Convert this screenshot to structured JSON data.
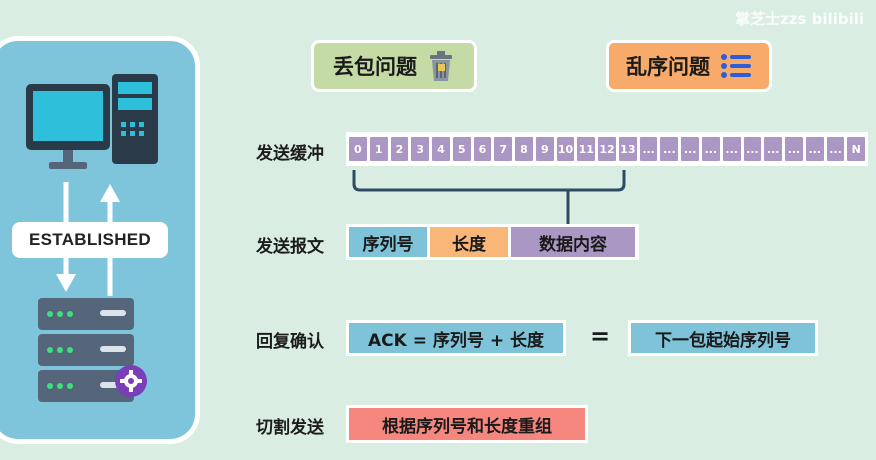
{
  "watermark": "掌芝士zzs bilibili",
  "left_panel": {
    "connection_state": "ESTABLISHED"
  },
  "tags": {
    "packet_loss": "丢包问题",
    "out_of_order": "乱序问题"
  },
  "rows": {
    "send_buffer_label": "发送缓冲",
    "send_segment_label": "发送报文",
    "ack_label": "回复确认",
    "split_label": "切割发送"
  },
  "buffer_cells": [
    "0",
    "1",
    "2",
    "3",
    "4",
    "5",
    "6",
    "7",
    "8",
    "9",
    "10",
    "11",
    "12",
    "13",
    "...",
    "...",
    "...",
    "...",
    "...",
    "...",
    "...",
    "...",
    "...",
    "...",
    "N"
  ],
  "segment": {
    "seq": "序列号",
    "length": "长度",
    "data": "数据内容"
  },
  "ack": {
    "formula": "ACK = 序列号 + 长度",
    "equals": "=",
    "result": "下一包起始序列号"
  },
  "reassemble": "根据序列号和长度重组",
  "colors": {
    "background": "#d9ede3",
    "panel": "#7ec5dc",
    "cell": "#ab97c3",
    "seq": "#7fc3d8",
    "length": "#f8b679",
    "data": "#ab97c3",
    "reassemble": "#f5877f",
    "loss_tag": "#c4dba6",
    "order_tag": "#f8aa6a"
  },
  "icons": {
    "loss": "trash-can-icon",
    "order": "list-icon",
    "client": "desktop-computer-icon",
    "server": "server-rack-icon",
    "gear": "gear-icon"
  }
}
